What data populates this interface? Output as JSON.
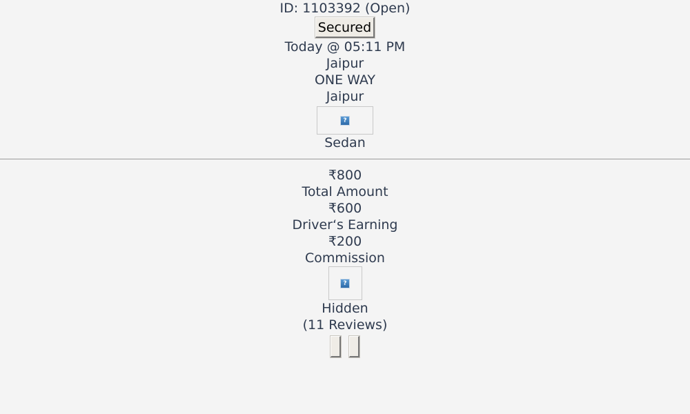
{
  "trip": {
    "id_text": "ID: 1103392 (Open)",
    "status_button": "Secured",
    "datetime": "Today @ 05:11 PM",
    "pickup": "Jaipur",
    "trip_type": "ONE WAY",
    "drop": "Jaipur",
    "car_image_icon": "broken-image-icon",
    "car_type": "Sedan"
  },
  "fare": {
    "total_value": "₹800",
    "total_label": "Total Amount",
    "driver_value": "₹600",
    "driver_label": "Driver‘s Earning",
    "commission_value": "₹200",
    "commission_label": "Commission"
  },
  "driver": {
    "avatar_icon": "broken-image-icon",
    "name": "Hidden",
    "reviews": "(11 Reviews)"
  }
}
